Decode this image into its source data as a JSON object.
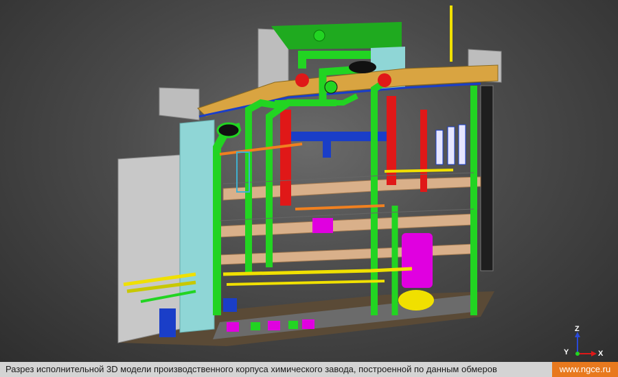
{
  "caption": {
    "text": "Разрез исполнительной 3D модели производственного корпуса химического завода, построенной по данным обмеров",
    "site": "www.ngce.ru"
  },
  "axes": {
    "z": "Z",
    "y": "Y",
    "x": "X"
  },
  "colors": {
    "background": "#4a4a4a",
    "caption_bar": "#d4d4d4",
    "site_badge": "#e8791e",
    "pipe_green": "#22d422",
    "pipe_red": "#e01818",
    "pipe_yellow": "#f0e000",
    "pipe_blue": "#1a3ec8",
    "vessel_magenta": "#e000e0",
    "slab_orange": "#d9a441",
    "wall_gray": "#bdbdbd",
    "wall_cyan": "#8fd6d6"
  }
}
